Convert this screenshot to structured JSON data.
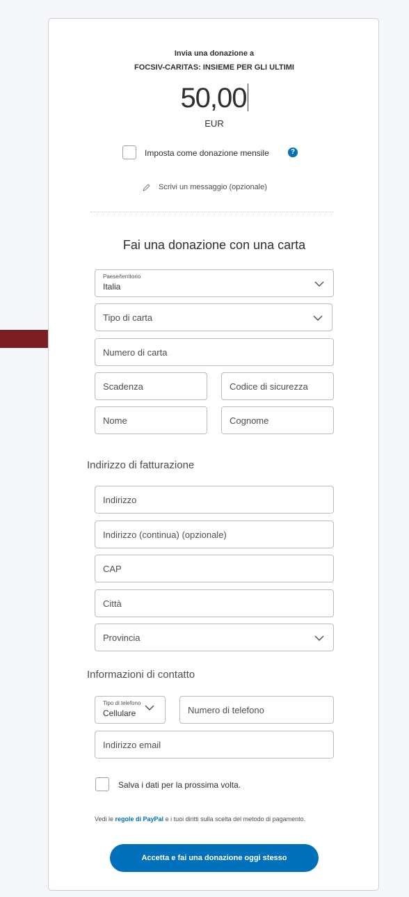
{
  "header": {
    "line1": "Invia una donazione a",
    "line2": "FOCSIV-CARITAS: INSIEME PER GLI ULTIMI"
  },
  "amount": {
    "value": "50,00",
    "currency": "EUR"
  },
  "monthly": {
    "label": "Imposta come donazione mensile",
    "checked": false,
    "help_icon": "question-circle-icon"
  },
  "message": {
    "icon": "pencil-icon",
    "label": "Scrivi un messaggio (opzionale)"
  },
  "card_section": {
    "title": "Fai una donazione con una carta",
    "country": {
      "label": "Paese/territorio",
      "value": "Italia"
    },
    "card_type": {
      "placeholder": "Tipo di carta"
    },
    "card_number": {
      "placeholder": "Numero di carta"
    },
    "expiry": {
      "placeholder": "Scadenza"
    },
    "security_code": {
      "placeholder": "Codice di sicurezza"
    },
    "first_name": {
      "placeholder": "Nome"
    },
    "last_name": {
      "placeholder": "Cognome"
    }
  },
  "billing": {
    "title": "Indirizzo di fatturazione",
    "address": {
      "placeholder": "Indirizzo"
    },
    "address2": {
      "placeholder": "Indirizzo (continua) (opzionale)"
    },
    "zip": {
      "placeholder": "CAP"
    },
    "city": {
      "placeholder": "Città"
    },
    "province": {
      "placeholder": "Provincia"
    }
  },
  "contact": {
    "title": "Informazioni di contatto",
    "phone_type": {
      "label": "Tipo di telefono",
      "value": "Cellulare"
    },
    "phone_number": {
      "placeholder": "Numero di telefono"
    },
    "email": {
      "placeholder": "Indirizzo email"
    }
  },
  "save": {
    "label": "Salva i dati per la prossima volta.",
    "checked": false
  },
  "legal": {
    "prefix": "Vedi le ",
    "link": "regole di PayPal",
    "suffix": " e i tuoi diritti sulla scelta del metodo di pagamento."
  },
  "cta": {
    "label": "Accetta e fai una donazione oggi stesso"
  },
  "colors": {
    "accent": "#0070ba",
    "arrow": "#7a1f22"
  }
}
